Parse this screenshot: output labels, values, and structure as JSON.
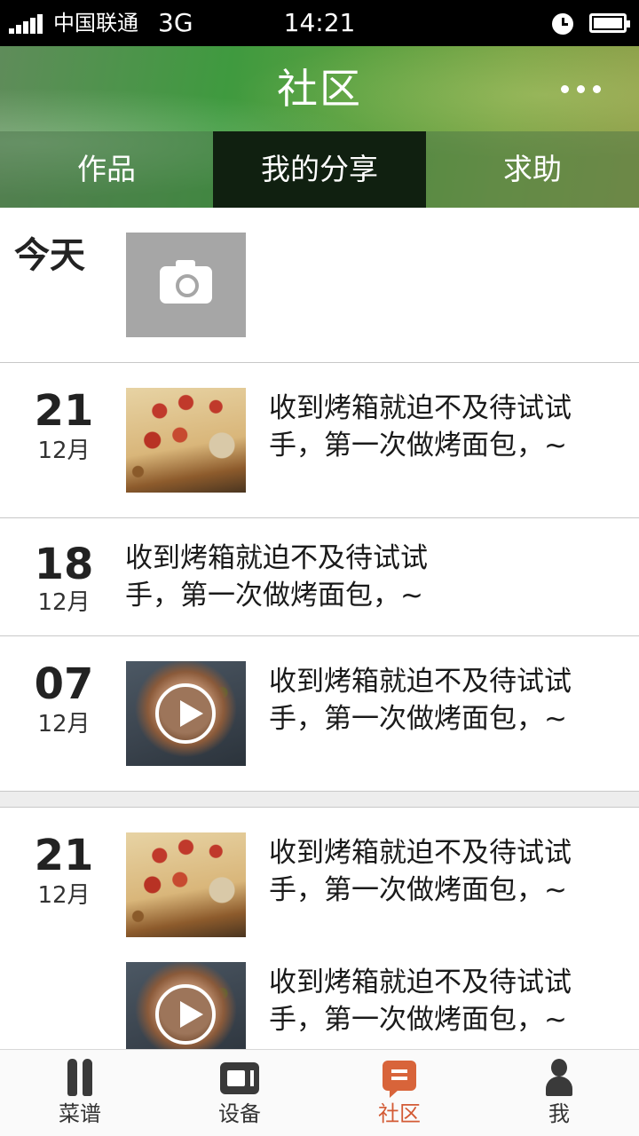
{
  "status_bar": {
    "carrier": "中国联通",
    "network": "3G",
    "time": "14:21"
  },
  "header": {
    "title": "社区"
  },
  "tabs": [
    {
      "label": "作品",
      "active": false
    },
    {
      "label": "我的分享",
      "active": true
    },
    {
      "label": "求助",
      "active": false
    }
  ],
  "today": {
    "label": "今天"
  },
  "posts": [
    {
      "day": "21",
      "month": "12月",
      "media": "pizza-photo",
      "line1": "收到烤箱就迫不及待试试",
      "line2": "手，第一次做烤面包，~"
    },
    {
      "day": "18",
      "month": "12月",
      "media": "none",
      "line1": "收到烤箱就迫不及待试试",
      "line2": "手，第一次做烤面包，~"
    },
    {
      "day": "07",
      "month": "12月",
      "media": "meat-video",
      "line1": "收到烤箱就迫不及待试试",
      "line2": "手，第一次做烤面包，~"
    }
  ],
  "group": {
    "day": "21",
    "month": "12月",
    "items": [
      {
        "media": "pizza-photo",
        "line1": "收到烤箱就迫不及待试试",
        "line2": "手，第一次做烤面包，~"
      },
      {
        "media": "meat-video",
        "line1": "收到烤箱就迫不及待试试",
        "line2": "手，第一次做烤面包，~"
      }
    ]
  },
  "bottom_nav": [
    {
      "label": "菜谱",
      "icon": "fork-knife-icon"
    },
    {
      "label": "设备",
      "icon": "device-icon"
    },
    {
      "label": "社区",
      "icon": "community-icon",
      "active": true
    },
    {
      "label": "我",
      "icon": "person-icon"
    }
  ],
  "colors": {
    "active_tab_bg": "#102010",
    "accent": "#d35a34",
    "header_green": "#3f9a3f"
  }
}
